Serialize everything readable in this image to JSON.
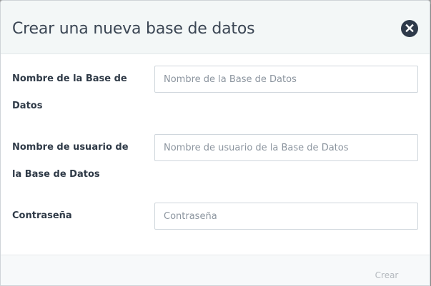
{
  "modal": {
    "title": "Crear una nueva base de datos",
    "close_icon": "close-circle-icon"
  },
  "form": {
    "fields": [
      {
        "label": "Nombre de la Base de Datos",
        "placeholder": "Nombre de la Base de Datos",
        "value": ""
      },
      {
        "label": "Nombre de usuario de la Base de Datos",
        "placeholder": "Nombre de usuario de la Base de Datos",
        "value": ""
      },
      {
        "label": "Contraseña",
        "placeholder": "Contraseña",
        "value": ""
      }
    ]
  },
  "footer": {
    "create_label": "Crear",
    "create_disabled": true
  },
  "colors": {
    "header_bg": "#f3f7f7",
    "title_text": "#3b4654",
    "close_bg": "#2e3a4a",
    "disabled_text": "#b4b9be"
  }
}
